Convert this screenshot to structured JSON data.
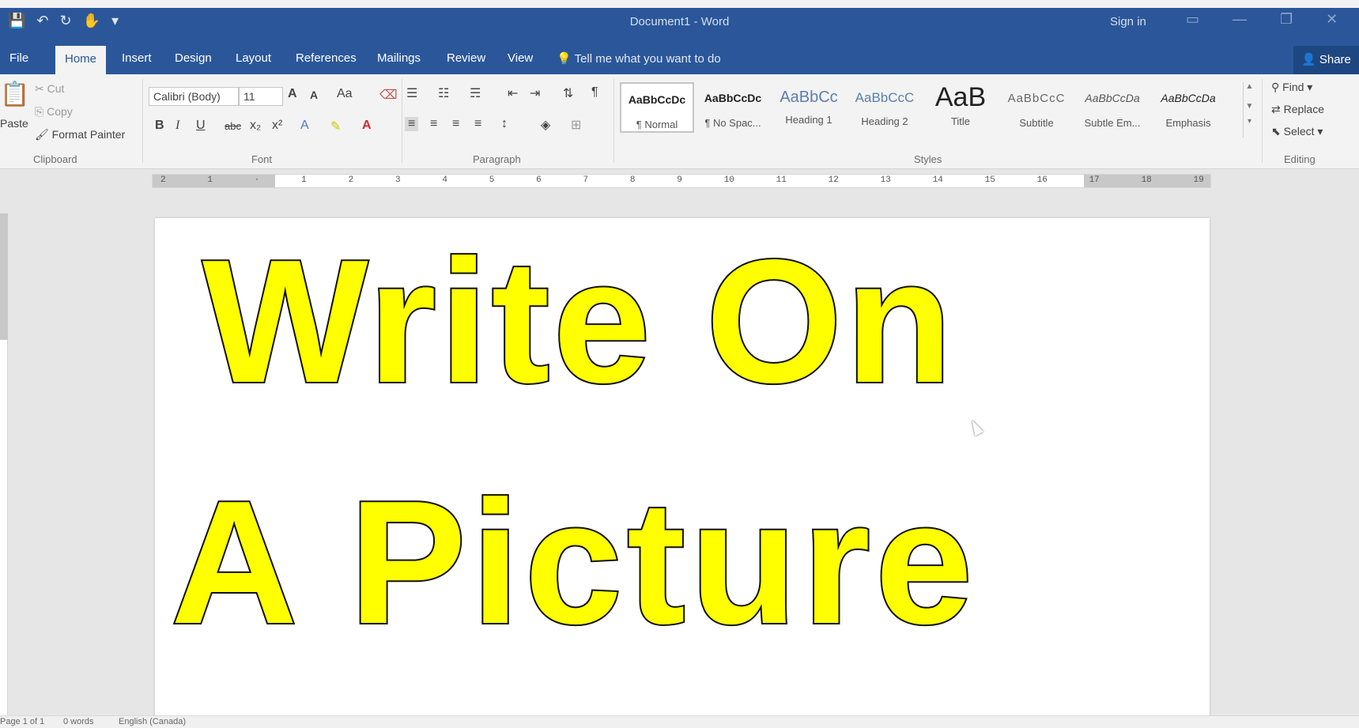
{
  "titlebar": {
    "title": "Document1  -  Word",
    "sign_in": "Sign in"
  },
  "tabs": {
    "file": "File",
    "home": "Home",
    "insert": "Insert",
    "design": "Design",
    "layout": "Layout",
    "references": "References",
    "mailings": "Mailings",
    "review": "Review",
    "view": "View",
    "tell_me": "Tell me what you want to do",
    "share": "Share"
  },
  "clipboard": {
    "cut": "Cut",
    "copy": "Copy",
    "format_painter": "Format Painter",
    "paste": "Paste",
    "label": "Clipboard"
  },
  "font": {
    "font_name": "Calibri (Body)",
    "font_size": "11",
    "label": "Font"
  },
  "paragraph": {
    "label": "Paragraph"
  },
  "styles": {
    "label": "Styles",
    "items": [
      {
        "sample": "AaBbCcDc",
        "name": "¶ Normal"
      },
      {
        "sample": "AaBbCcDc",
        "name": "¶ No Spac..."
      },
      {
        "sample": "AaBbCc",
        "name": "Heading 1"
      },
      {
        "sample": "AaBbCcC",
        "name": "Heading 2"
      },
      {
        "sample": "AaB",
        "name": "Title"
      },
      {
        "sample": "AaBbCcC",
        "name": "Subtitle"
      },
      {
        "sample": "AaBbCcDa",
        "name": "Subtle Em..."
      },
      {
        "sample": "AaBbCcDa",
        "name": "Emphasis"
      }
    ]
  },
  "editing": {
    "find": "Find",
    "replace": "Replace",
    "select": "Select",
    "label": "Editing"
  },
  "ruler": {
    "numbers": [
      "2",
      "1",
      "",
      "1",
      "2",
      "3",
      "4",
      "5",
      "6",
      "7",
      "8",
      "9",
      "10",
      "11",
      "12",
      "13",
      "14",
      "15",
      "16",
      "17",
      "18",
      "19"
    ]
  },
  "document": {
    "line1": "Write On",
    "line2": "A Picture"
  },
  "status": {
    "page": "Page 1 of 1",
    "words": "0 words",
    "language": "English (Canada)"
  },
  "colors": {
    "accent": "#2b579a",
    "wordart_fill": "#ffff00",
    "wordart_outline": "#111111"
  }
}
